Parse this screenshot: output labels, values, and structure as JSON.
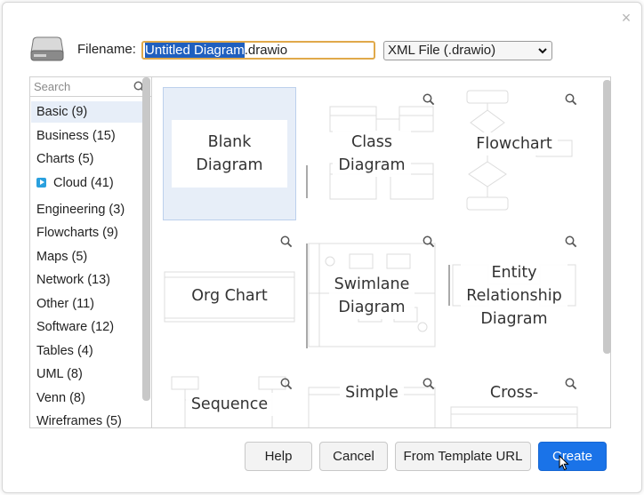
{
  "dialog": {
    "close_glyph": "×",
    "filename_label": "Filename:",
    "filename_selected": "Untitled Diagram",
    "filename_rest": ".drawio",
    "format": {
      "selected": "XML File (.drawio)"
    }
  },
  "sidebar": {
    "search_placeholder": "Search",
    "categories": [
      "Basic (9)",
      "Business (15)",
      "Charts (5)",
      "Cloud (41)",
      "Engineering (3)",
      "Flowcharts (9)",
      "Maps (5)",
      "Network (13)",
      "Other (11)",
      "Software (12)",
      "Tables (4)",
      "UML (8)",
      "Venn (8)",
      "Wireframes (5)"
    ],
    "active_category": "Basic (9)"
  },
  "templates": [
    {
      "label": "Blank Diagram",
      "line1": "Blank",
      "line2": "Diagram",
      "selected": true
    },
    {
      "label": "Class Diagram",
      "line1": "Class",
      "line2": "Diagram"
    },
    {
      "label": "Flowchart",
      "line1": "Flowchart"
    },
    {
      "label": "Org Chart",
      "line1": "Org Chart"
    },
    {
      "label": "Swimlane Diagram",
      "line1": "Swimlane",
      "line2": "Diagram"
    },
    {
      "label": "Entity Relationship Diagram",
      "line1": "Entity",
      "line2": "Relationship",
      "line3": "Diagram"
    },
    {
      "label": "Sequence",
      "line1": "Sequence"
    },
    {
      "label": "Simple",
      "line1": "Simple"
    },
    {
      "label": "Cross-",
      "line1": "Cross-"
    }
  ],
  "buttons": {
    "help": "Help",
    "cancel": "Cancel",
    "from_template_url": "From Template URL",
    "create": "Create"
  },
  "colors": {
    "accent": "#1a73e8",
    "selection": "#e7eef8",
    "focus_border": "#e0a94a",
    "cloud_icon": "#2aa0de"
  },
  "icons": {
    "drive": "hard-drive-icon",
    "search": "magnifier-icon",
    "zoom": "magnifier-icon",
    "close": "close-icon",
    "cloud": "play-badge-icon",
    "dropdown": "chevron-down-icon"
  }
}
